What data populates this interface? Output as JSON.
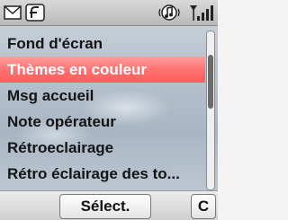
{
  "status_bar": {
    "icons": [
      "message-icon",
      "brand-icon",
      "ringtone-icon",
      "signal-icon"
    ]
  },
  "menu": {
    "items": [
      {
        "label": "Fond d'écran"
      },
      {
        "label": "Thèmes en couleur"
      },
      {
        "label": "Msg accueil"
      },
      {
        "label": "Note opérateur"
      },
      {
        "label": "Rétroeclairage"
      },
      {
        "label": "Rétro éclairage des to..."
      }
    ]
  },
  "softkeys": {
    "select_label": "Sélect.",
    "clear_label": "C"
  },
  "colors": {
    "selection": "#ff6f6f",
    "selection_text": "#ffffff",
    "text": "#141414"
  }
}
